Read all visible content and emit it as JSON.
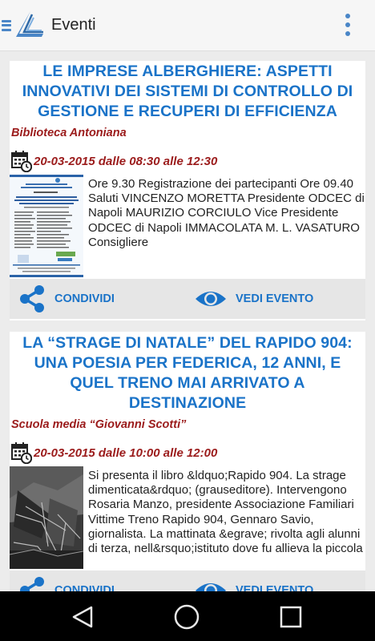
{
  "appbar": {
    "title": "Eventi",
    "icons": [
      "menu-icon",
      "app-logo",
      "overflow-menu-icon"
    ]
  },
  "colors": {
    "accent": "#1a73c8",
    "highlight": "#9b1b1b",
    "nav_bar": "#000000"
  },
  "events": [
    {
      "title": "LE IMPRESE ALBERGHIERE: ASPETTI INNOVATIVI DEI SISTEMI DI CONTROLLO DI GESTIONE E RECUPERI DI EFFICIENZA",
      "location": "Biblioteca Antoniana",
      "date": "20-03-2015 dalle 08:30 alle 12:30",
      "description": "Ore 9.30 Registrazione dei partecipanti Ore 09.40 Saluti VINCENZO MORETTA Presidente ODCEC di Napoli MAURIZIO CORCIULO Vice Presidente ODCEC di Napoli IMMACOLATA M. L. VASATURO Consigliere",
      "share_label": "CONDIVIDI",
      "view_label": "VEDI EVENTO"
    },
    {
      "title": "LA “STRAGE DI NATALE” DEL RAPIDO 904: UNA POESIA PER FEDERICA, 12 ANNI, E QUEL TRENO MAI ARRIVATO A DESTINAZIONE",
      "location": "Scuola media “Giovanni Scotti”",
      "date": "20-03-2015 dalle 10:00 alle 12:00",
      "description": "Si presenta il libro &ldquo;Rapido 904. La strage dimenticata&rdquo; (grauseditore). Intervengono Rosaria Manzo, presidente Associazione Familiari Vittime Treno Rapido 904, Gennaro Savio, giornalista. La mattinata &egrave; rivolta agli alunni di terza, nell&rsquo;istituto dove fu allieva la piccola",
      "share_label": "CONDIVIDI",
      "view_label": "VEDI EVENTO"
    }
  ],
  "navbar": {
    "icons": [
      "back-icon",
      "home-icon",
      "recents-icon"
    ]
  }
}
